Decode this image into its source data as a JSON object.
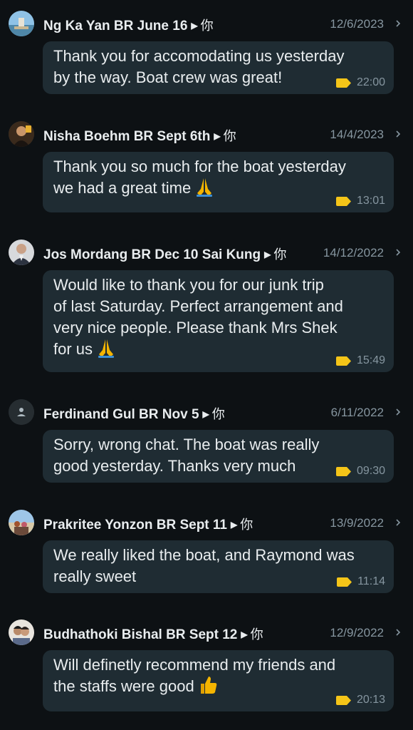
{
  "chats": [
    {
      "name": "Ng Ka Yan BR June 16",
      "recipient": "你",
      "date": "12/6/2023",
      "text": "Thank you for accomodating us yesterday\nby the way. Boat crew was great!",
      "emoji": "",
      "time": "22:00",
      "avatar": "photo-harbor"
    },
    {
      "name": "Nisha Boehm BR Sept 6th",
      "recipient": "你",
      "date": "14/4/2023",
      "text": "Thank you so much for the boat yesterday\nwe had a great time",
      "emoji": "folded-hands",
      "time": "13:01",
      "avatar": "photo-person-dark"
    },
    {
      "name": "Jos Mordang BR Dec 10 Sai Kung",
      "recipient": "你",
      "date": "14/12/2022",
      "text": "Would like to thank you for our junk trip\nof last Saturday. Perfect arrangement and\nvery nice people. Please thank Mrs Shek\nfor us",
      "emoji": "folded-hands",
      "time": "15:49",
      "avatar": "photo-man-suit"
    },
    {
      "name": "Ferdinand Gul BR Nov 5",
      "recipient": "你",
      "date": "6/11/2022",
      "text": "Sorry, wrong chat. The boat was really\ngood yesterday. Thanks very much",
      "emoji": "",
      "time": "09:30",
      "avatar": "default-person-icon"
    },
    {
      "name": "Prakritee Yonzon BR Sept 11",
      "recipient": "你",
      "date": "13/9/2022",
      "text": "We really liked the boat, and Raymond was\nreally sweet",
      "emoji": "",
      "time": "11:14",
      "avatar": "photo-group"
    },
    {
      "name": "Budhathoki Bishal BR Sept 12",
      "recipient": "你",
      "date": "12/9/2022",
      "text": "Will definetly recommend my friends and\nthe staffs were good",
      "emoji": "thumbs-up",
      "time": "20:13",
      "avatar": "photo-couple"
    }
  ],
  "colors": {
    "background": "#0d1114",
    "bubble": "#1f2c33",
    "label_tag": "#f5c518",
    "secondary_text": "#8696a0"
  }
}
